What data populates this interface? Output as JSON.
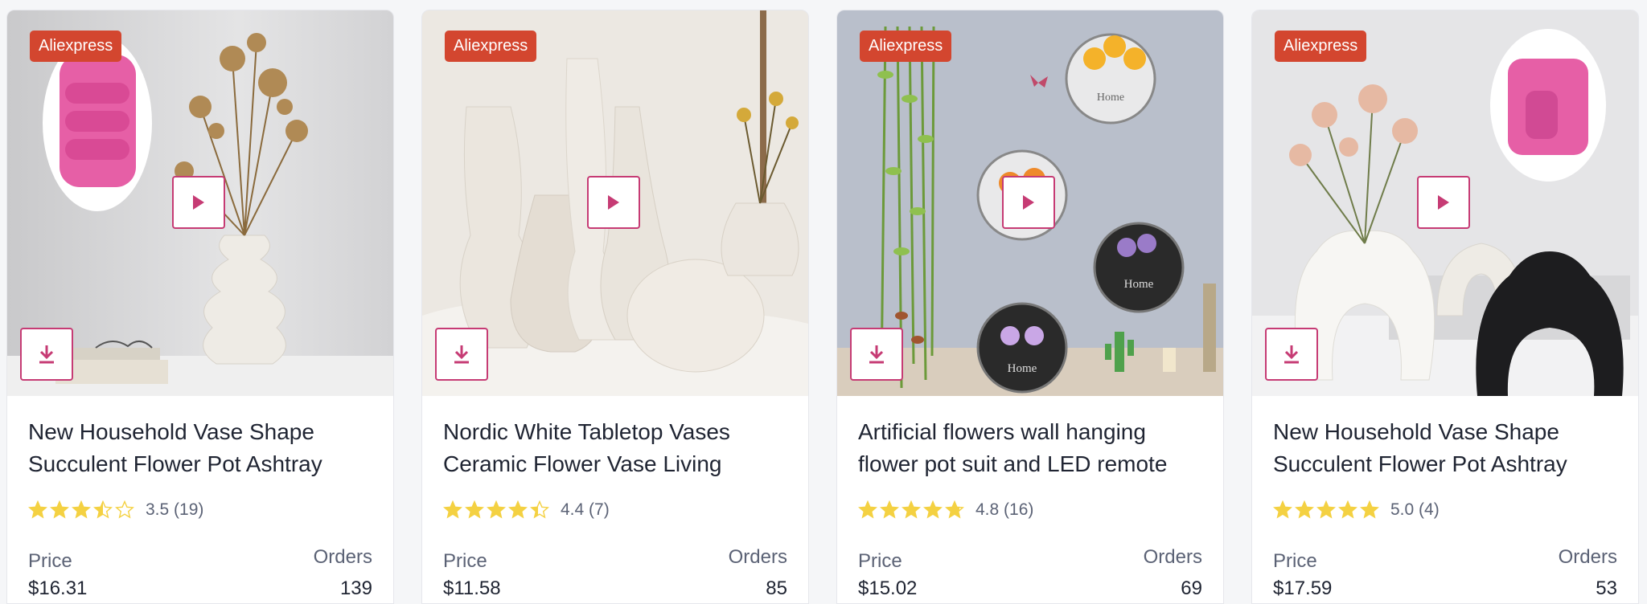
{
  "colors": {
    "badge": "#d3462f",
    "button_border": "#c63b74",
    "button_icon": "#c63b74",
    "star": "#f4d142",
    "star_empty": "#d8d8d8"
  },
  "products": [
    {
      "source_badge": "Aliexpress",
      "title_line1": "New Household Vase Shape",
      "title_line2": "Succulent Flower Pot Ashtray",
      "rating": 3.5,
      "rating_text": "3.5 (19)",
      "price_label": "Price",
      "price": "$16.31",
      "orders_label": "Orders",
      "orders": "139",
      "play_icon": "play-icon",
      "download_icon": "download-icon"
    },
    {
      "source_badge": "Aliexpress",
      "title_line1": "Nordic White Tabletop Vases",
      "title_line2": "Ceramic Flower Vase Living",
      "rating": 4.4,
      "rating_text": "4.4 (7)",
      "price_label": "Price",
      "price": "$11.58",
      "orders_label": "Orders",
      "orders": "85",
      "play_icon": "play-icon",
      "download_icon": "download-icon"
    },
    {
      "source_badge": "Aliexpress",
      "title_line1": "Artificial flowers wall hanging",
      "title_line2": "flower pot suit and LED remote",
      "rating": 4.8,
      "rating_text": "4.8 (16)",
      "price_label": "Price",
      "price": "$15.02",
      "orders_label": "Orders",
      "orders": "69",
      "play_icon": "play-icon",
      "download_icon": "download-icon"
    },
    {
      "source_badge": "Aliexpress",
      "title_line1": "New Household Vase Shape",
      "title_line2": "Succulent Flower Pot Ashtray",
      "rating": 5.0,
      "rating_text": "5.0 (4)",
      "price_label": "Price",
      "price": "$17.59",
      "orders_label": "Orders",
      "orders": "53",
      "play_icon": "play-icon",
      "download_icon": "download-icon"
    }
  ],
  "images": {
    "card0": {
      "sign_text": ""
    },
    "card2": {
      "sign_text_1": "Home",
      "sign_text_2": "Home",
      "sign_text_3": "Home"
    }
  }
}
